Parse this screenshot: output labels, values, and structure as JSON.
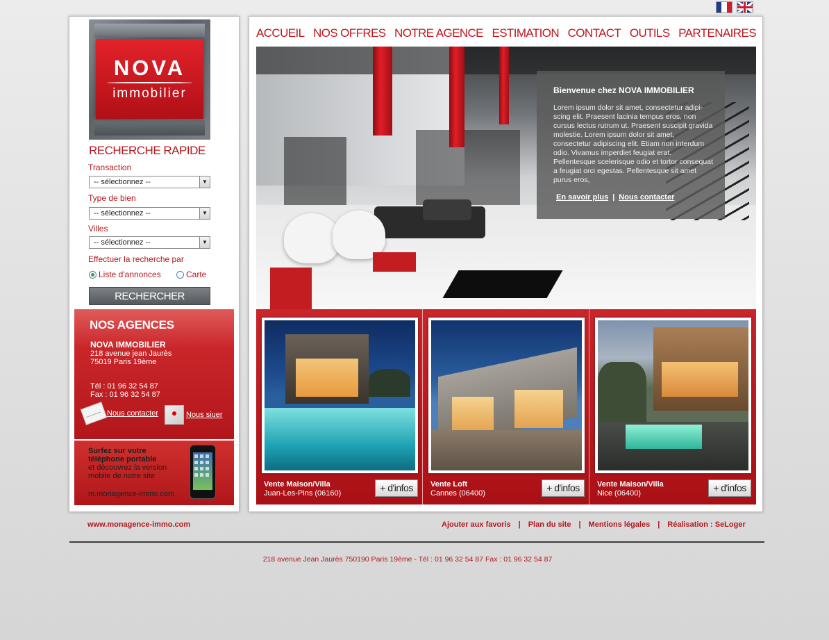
{
  "flags": {
    "fr": "Français",
    "en": "English"
  },
  "logo": {
    "brand": "NOVA",
    "sub": "immobilier"
  },
  "search": {
    "title": "RECHERCHE RAPIDE",
    "fields": [
      {
        "label": "Transaction",
        "value": "-- sélectionnez --"
      },
      {
        "label": "Type de bien",
        "value": "-- sélectionnez --"
      },
      {
        "label": "Villes",
        "value": "-- sélectionnez --"
      }
    ],
    "mode_label": "Effectuer la recherche par",
    "mode_options": [
      "Liste d'annonces",
      "Carte"
    ],
    "button": "RECHERCHER"
  },
  "agencies": {
    "title": "NOS AGENCES",
    "name": "NOVA IMMOBILIER",
    "address1": "218 avenue jean Jaurès",
    "address2": "75019 Paris 19ème",
    "tel": "Tél : 01 96 32 54 87",
    "fax": "Fax : 01 96 32 54 87",
    "contact_link": "Nous contacter",
    "locate_link": "Nous siuer"
  },
  "mobile": {
    "line1": "Surfez sur votre",
    "line2": "téléphone portable",
    "line3": "et découvrez la version",
    "line4": "mobile de notre site",
    "url": "m.monagence-immo.com"
  },
  "nav": [
    "ACCUEIL",
    "NOS OFFRES",
    "NOTRE AGENCE",
    "ESTIMATION",
    "CONTACT",
    "OUTILS",
    "PARTENAIRES"
  ],
  "welcome": {
    "title": "Bienvenue chez NOVA IMMOBILIER",
    "text": "Lorem ipsum dolor sit amet, consectetur adipi-scing elit. Praesent lacinia tempus eros, non cursus lectus rutrum ut. Praesent suscipit gravida molestie. Lorem ipsum dolor sit amet, consectetur adipiscing elit. Etiam non interdum odio. Vivamus imperdiet feugiat erat. Pellentesque scelerisque odio et tortor consequat a feugiat orci egestas. Pellentesque sit amet purus eros,",
    "link1": "En savoir plus",
    "separator": "|",
    "link2": "Nous contacter"
  },
  "listings": [
    {
      "type": "Vente Maison/Villa",
      "city": "Juan-Les-Pins (06160)",
      "button": "+ d'infos"
    },
    {
      "type": "Vente Loft",
      "city": "Cannes (06400)",
      "button": "+ d'infos"
    },
    {
      "type": "Vente Maison/Villa",
      "city": "Nice (06400)",
      "button": "+ d'infos"
    }
  ],
  "footer": {
    "url": "www.monagence-immo.com",
    "links": [
      "Ajouter aux favoris",
      "Plan du site",
      "Mentions légales",
      "Réalisation : SeLoger"
    ],
    "separator": "|",
    "address": "218 avenue Jean Jaurès 750190 Paris 19ème -  Tél : 01 96 32 54 87  Fax : 01 96 32 54 87"
  },
  "colors": {
    "accent_red": "#b5161c",
    "panel_bg": "#ffffff",
    "page_bg": "#e4e4e4"
  }
}
